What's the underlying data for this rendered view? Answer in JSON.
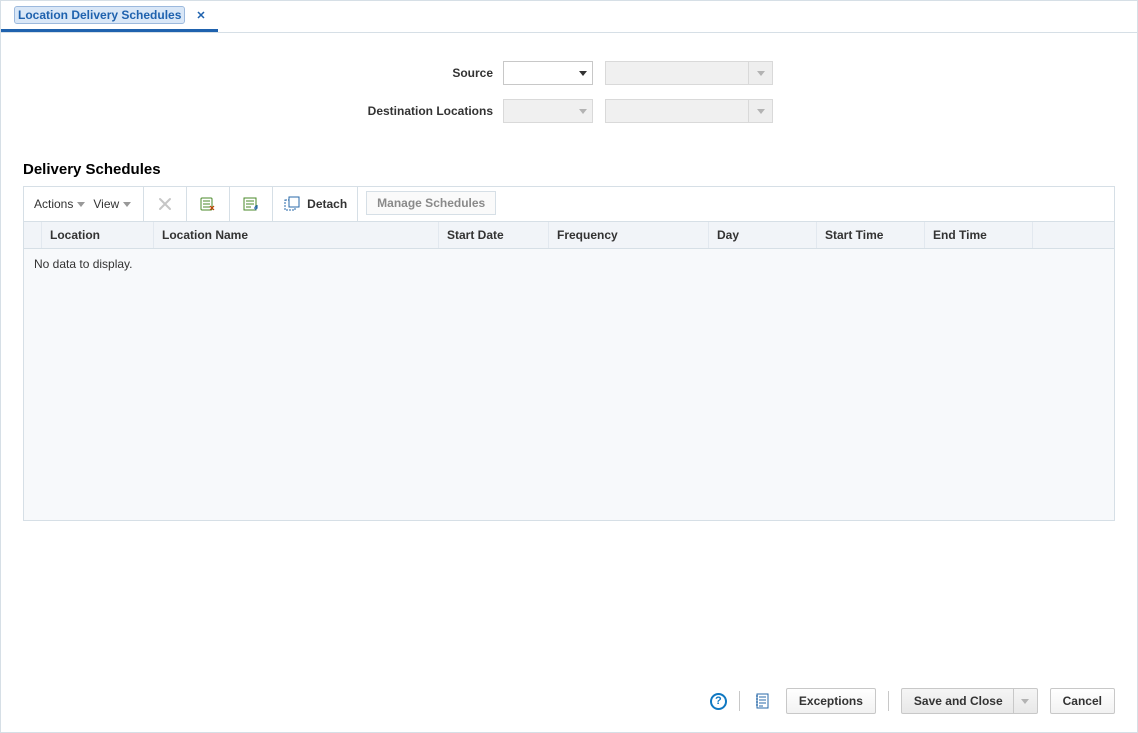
{
  "tab": {
    "label": "Location Delivery Schedules"
  },
  "form": {
    "source_label": "Source",
    "destination_label": "Destination Locations"
  },
  "section": {
    "title": "Delivery Schedules"
  },
  "toolbar": {
    "actions_label": "Actions",
    "view_label": "View",
    "detach_label": "Detach",
    "manage_label": "Manage Schedules"
  },
  "grid": {
    "columns": {
      "location": "Location",
      "location_name": "Location Name",
      "start_date": "Start Date",
      "frequency": "Frequency",
      "day": "Day",
      "start_time": "Start Time",
      "end_time": "End Time"
    },
    "empty_message": "No data to display."
  },
  "footer": {
    "exceptions_label": "Exceptions",
    "save_close_label": "Save and Close",
    "cancel_label": "Cancel"
  }
}
